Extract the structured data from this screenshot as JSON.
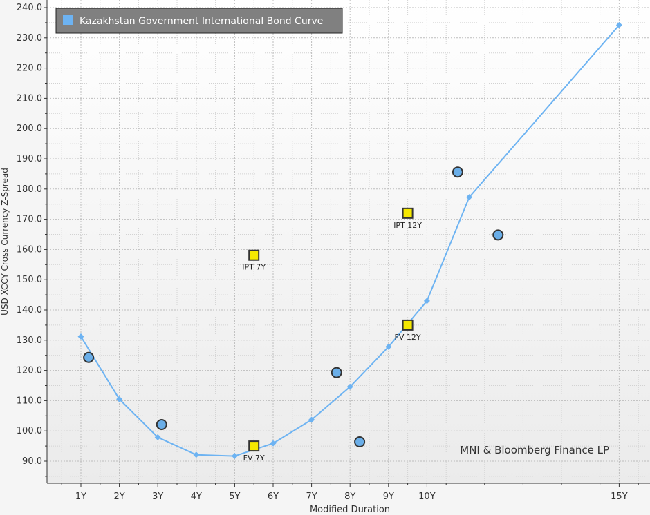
{
  "chart_data": {
    "type": "scatter",
    "title": "",
    "xlabel": "Modified Duration",
    "ylabel": "USD XCCY Cross Currency Z-Spread",
    "xlim": [
      0.1,
      15.5
    ],
    "ylim": [
      83,
      242
    ],
    "x_ticks": [
      {
        "v": 1,
        "label": "1Y"
      },
      {
        "v": 2,
        "label": "2Y"
      },
      {
        "v": 3,
        "label": "3Y"
      },
      {
        "v": 4,
        "label": "4Y"
      },
      {
        "v": 5,
        "label": "5Y"
      },
      {
        "v": 6,
        "label": "6Y"
      },
      {
        "v": 7,
        "label": "7Y"
      },
      {
        "v": 8,
        "label": "8Y"
      },
      {
        "v": 9,
        "label": "9Y"
      },
      {
        "v": 10,
        "label": "10Y"
      },
      {
        "v": 15,
        "label": "15Y"
      }
    ],
    "y_ticks": [
      {
        "v": 90,
        "label": "90.0"
      },
      {
        "v": 100,
        "label": "100.0"
      },
      {
        "v": 110,
        "label": "110.0"
      },
      {
        "v": 120,
        "label": "120.0"
      },
      {
        "v": 130,
        "label": "130.0"
      },
      {
        "v": 140,
        "label": "140.0"
      },
      {
        "v": 150,
        "label": "150.0"
      },
      {
        "v": 160,
        "label": "160.0"
      },
      {
        "v": 170,
        "label": "170.0"
      },
      {
        "v": 180,
        "label": "180.0"
      },
      {
        "v": 190,
        "label": "190.0"
      },
      {
        "v": 200,
        "label": "200.0"
      },
      {
        "v": 210,
        "label": "210.0"
      },
      {
        "v": 220,
        "label": "220.0"
      },
      {
        "v": 230,
        "label": "230.0"
      },
      {
        "v": 240,
        "label": "240.0"
      }
    ],
    "grid": true,
    "legend_position": "top-left",
    "series": [
      {
        "name": "Kazakhstan Government International Bond Curve",
        "kind": "curve",
        "color": "#6db3f2",
        "points": [
          {
            "x": 1,
            "y": 131.2
          },
          {
            "x": 2,
            "y": 110.5
          },
          {
            "x": 3,
            "y": 97.9
          },
          {
            "x": 4,
            "y": 92.1
          },
          {
            "x": 5,
            "y": 91.7
          },
          {
            "x": 6,
            "y": 95.9
          },
          {
            "x": 7,
            "y": 103.7
          },
          {
            "x": 8,
            "y": 114.6
          },
          {
            "x": 9,
            "y": 127.8
          },
          {
            "x": 10,
            "y": 143.0
          },
          {
            "x": 11.1,
            "y": 177.3
          },
          {
            "x": 15,
            "y": 234.2
          }
        ]
      },
      {
        "kind": "bonds",
        "color": "#6aaee8",
        "points": [
          {
            "x": 1.2,
            "y": 124.3
          },
          {
            "x": 3.1,
            "y": 102.1
          },
          {
            "x": 7.65,
            "y": 119.3
          },
          {
            "x": 8.25,
            "y": 96.4
          },
          {
            "x": 10.8,
            "y": 185.6
          },
          {
            "x": 11.85,
            "y": 164.8
          }
        ]
      },
      {
        "kind": "new-issue",
        "color": "#f5e800",
        "points": [
          {
            "x": 5.5,
            "y": 158.1,
            "label": "IPT 7Y"
          },
          {
            "x": 9.5,
            "y": 172.0,
            "label": "IPT 12Y"
          },
          {
            "x": 5.5,
            "y": 95.0,
            "label": "FV 7Y"
          },
          {
            "x": 9.5,
            "y": 135.0,
            "label": "FV 12Y"
          }
        ]
      }
    ],
    "annotation": "MNI & Bloomberg Finance LP",
    "colors": {
      "legend_bg": "#808080",
      "legend_text": "#ffffff",
      "marker_outline": "#333333"
    }
  }
}
